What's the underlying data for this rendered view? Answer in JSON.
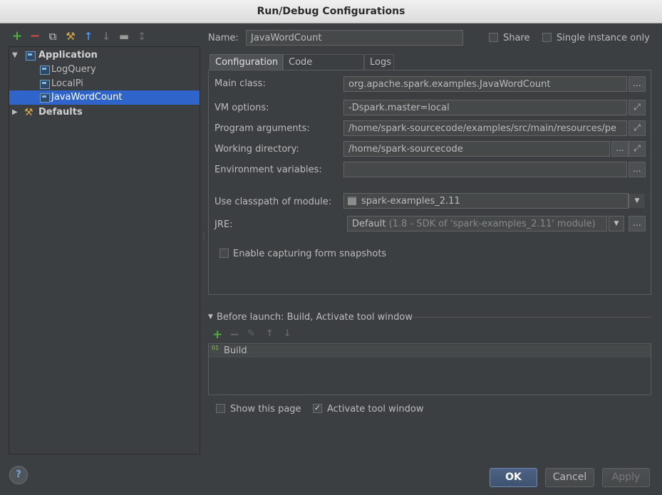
{
  "window": {
    "title": "Run/Debug Configurations"
  },
  "toolbar": {
    "icons": [
      "add-icon",
      "remove-icon",
      "copy-icon",
      "wrench-icon",
      "move-up-icon",
      "move-down-icon",
      "folder-icon",
      "sort-icon"
    ],
    "glyphs": {
      "add": "+",
      "remove": "−",
      "copy": "⧉",
      "wrench": "⚒",
      "up": "↑",
      "down": "↓",
      "folder": "▬",
      "sort": "↕"
    }
  },
  "tree": {
    "application_label": "Application",
    "items": [
      "LogQuery",
      "LocalPi",
      "JavaWordCount"
    ],
    "selected": "JavaWordCount",
    "defaults_label": "Defaults"
  },
  "header": {
    "name_label": "Name:",
    "name_value": "JavaWordCount",
    "share_label": "Share",
    "single_instance_label": "Single instance only"
  },
  "tabs": [
    "Configuration",
    "Code Coverage",
    "Logs"
  ],
  "config": {
    "main_class_label": "Main class:",
    "main_class_value": "org.apache.spark.examples.JavaWordCount",
    "vm_options_label": "VM options:",
    "vm_options_value": "-Dspark.master=local",
    "program_args_label": "Program arguments:",
    "program_args_value": "/home/spark-sourcecode/examples/src/main/resources/pe",
    "working_dir_label": "Working directory:",
    "working_dir_value": "/home/spark-sourcecode",
    "env_vars_label": "Environment variables:",
    "env_vars_value": "",
    "classpath_label": "Use classpath of module:",
    "classpath_value": "spark-examples_2.11",
    "jre_label": "JRE:",
    "jre_value_default": "Default",
    "jre_value_detail": "(1.8 - SDK of 'spark-examples_2.11' module)",
    "capture_snapshots_label": "Enable capturing form snapshots",
    "ellipsis": "...",
    "expand_glyph": "⤢"
  },
  "before_launch": {
    "title": "Before launch: Build, Activate tool window",
    "items": [
      "Build"
    ],
    "build_icon_text": "01"
  },
  "footer": {
    "show_page_label": "Show this page",
    "activate_tool_label": "Activate tool window",
    "help": "?",
    "ok": "OK",
    "cancel": "Cancel",
    "apply": "Apply"
  },
  "colors": {
    "background": "#3c3f41",
    "selection": "#2f65ca",
    "add_green": "#4dae3f",
    "remove_red": "#d04a4a",
    "arrow_blue": "#4c8ee8"
  }
}
